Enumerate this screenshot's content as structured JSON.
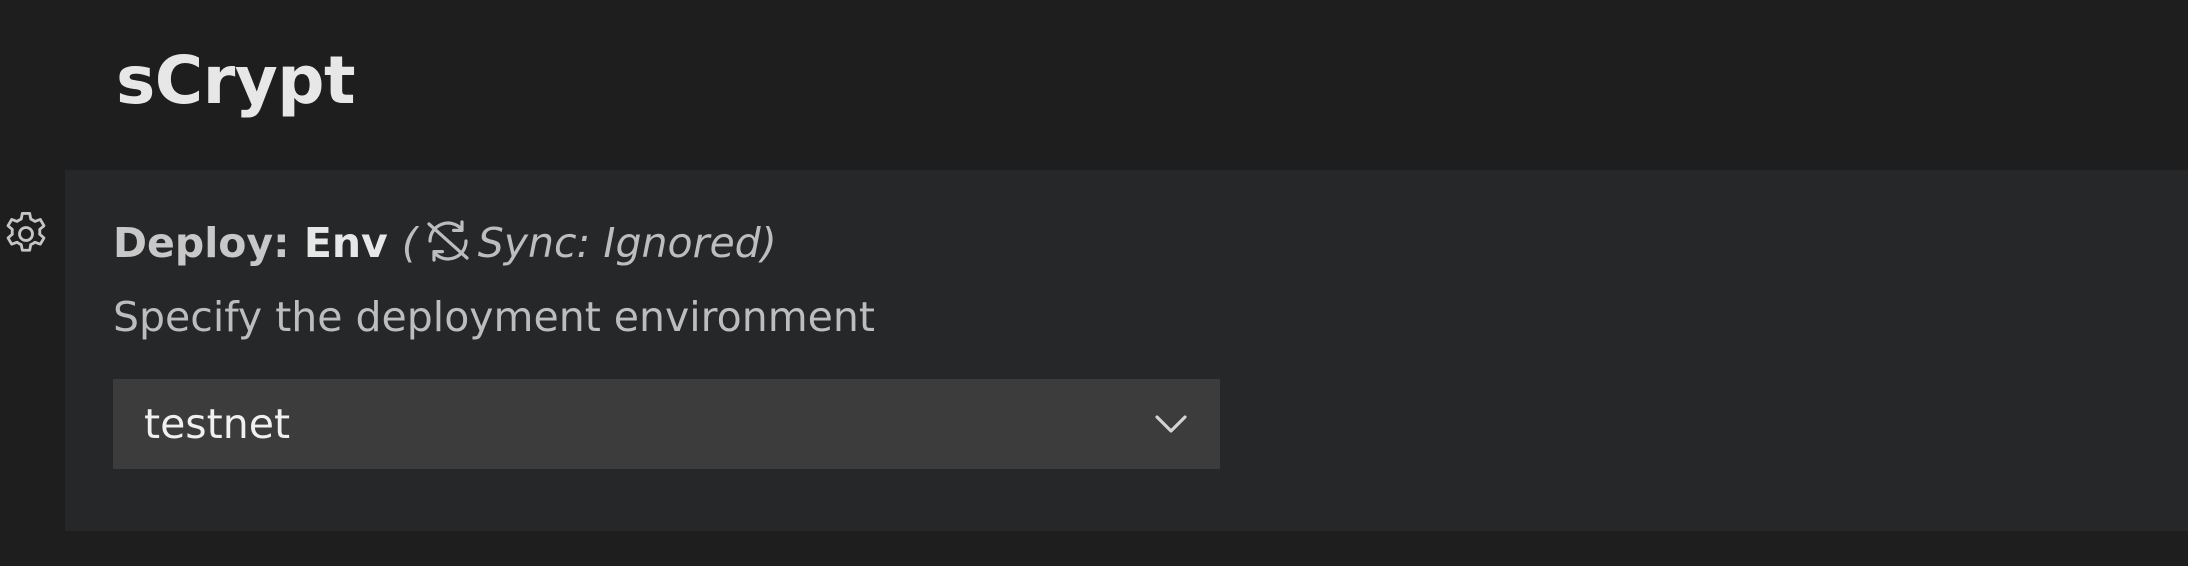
{
  "section": {
    "title": "sCrypt"
  },
  "setting": {
    "category": "Deploy: ",
    "key": "Env",
    "sync_prefix": "(",
    "sync_text": "Sync: Ignored)",
    "description": "Specify the deployment environment",
    "select": {
      "value": "testnet"
    }
  },
  "icons": {
    "gear": "gear-icon",
    "sync": "sync-ignored-icon",
    "chevron": "chevron-down-icon"
  },
  "colors": {
    "background": "#1e1e1e",
    "panel": "#262729",
    "select_bg": "#3c3c3c",
    "text": "#cccccc"
  }
}
